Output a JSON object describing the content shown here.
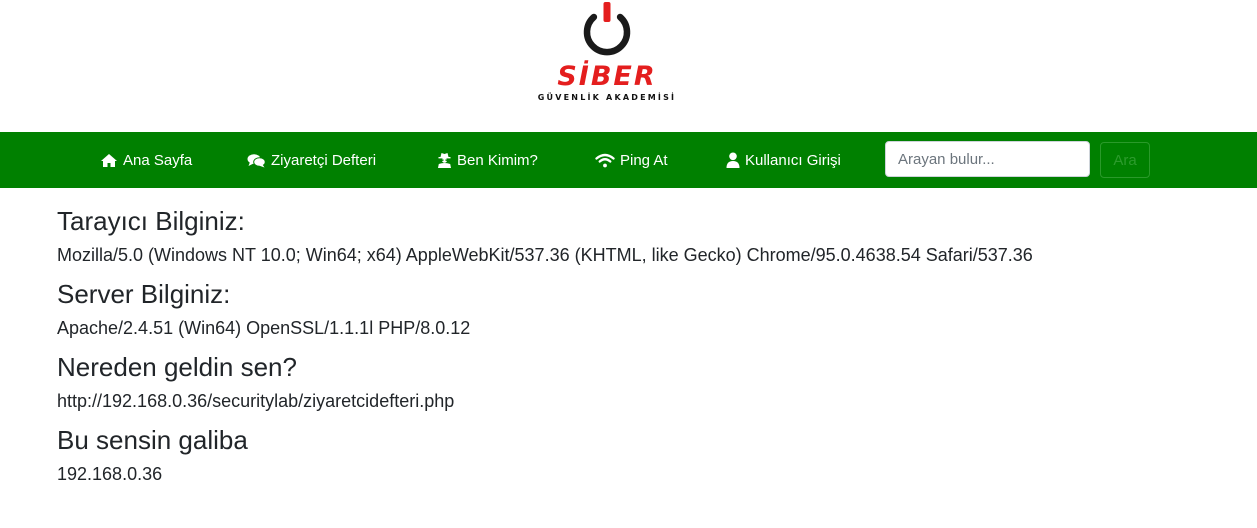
{
  "logo": {
    "brand": "SİBER",
    "tagline": "GÜVENLİK AKADEMİSİ"
  },
  "nav": {
    "items": [
      {
        "label": "Ana Sayfa",
        "icon": "home-icon"
      },
      {
        "label": "Ziyaretçi Defteri",
        "icon": "comments-icon"
      },
      {
        "label": "Ben Kimim?",
        "icon": "user-secret-icon"
      },
      {
        "label": "Ping At",
        "icon": "wifi-icon"
      },
      {
        "label": "Kullanıcı Girişi",
        "icon": "user-icon"
      }
    ],
    "search_placeholder": "Arayan bulur...",
    "search_button": "Ara"
  },
  "info": {
    "browser_heading": "Tarayıcı Bilginiz:",
    "browser_value": "Mozilla/5.0 (Windows NT 10.0; Win64; x64) AppleWebKit/537.36 (KHTML, like Gecko) Chrome/95.0.4638.54 Safari/537.36",
    "server_heading": "Server Bilginiz:",
    "server_value": "Apache/2.4.51 (Win64) OpenSSL/1.1.1l PHP/8.0.12",
    "referer_heading": "Nereden geldin sen?",
    "referer_value": "http://192.168.0.36/securitylab/ziyaretcidefteri.php",
    "ip_heading": "Bu sensin galiba",
    "ip_value": "192.168.0.36"
  },
  "colors": {
    "navbar": "#008000",
    "brand": "#e41e1e",
    "text": "#212529"
  }
}
